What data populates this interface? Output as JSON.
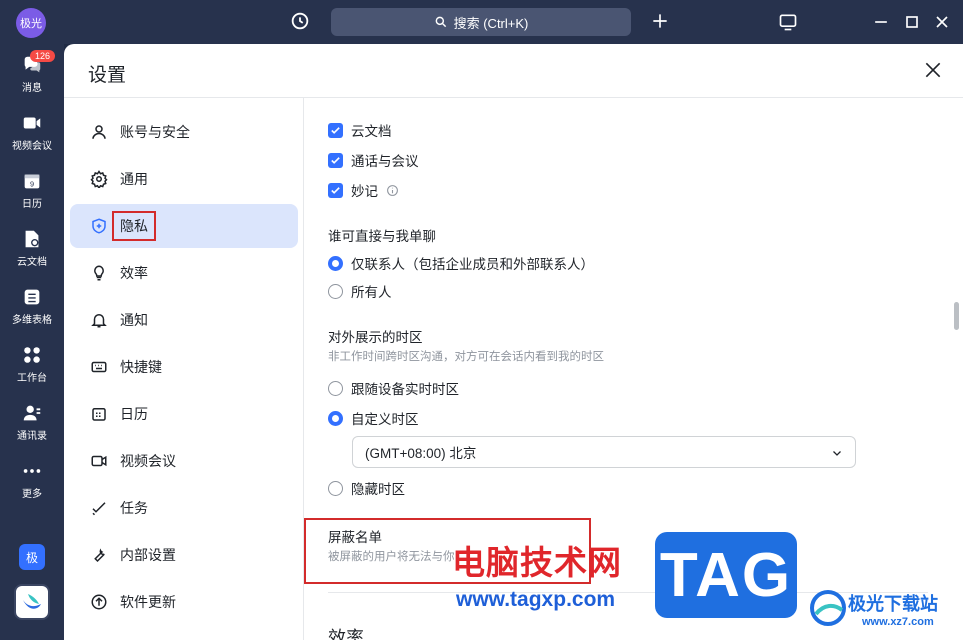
{
  "topbar": {
    "avatar_label": "极光",
    "search_label": "搜索 (Ctrl+K)"
  },
  "leftnav": {
    "items": [
      {
        "label": "消息",
        "icon": "chat-bubbles-icon",
        "badge": "126"
      },
      {
        "label": "视频会议",
        "icon": "video-camera-icon"
      },
      {
        "label": "日历",
        "icon": "calendar-icon",
        "day": "9"
      },
      {
        "label": "云文档",
        "icon": "cloud-doc-icon"
      },
      {
        "label": "多维表格",
        "icon": "grid-table-icon"
      },
      {
        "label": "工作台",
        "icon": "apps-grid-icon"
      },
      {
        "label": "通讯录",
        "icon": "contacts-icon"
      },
      {
        "label": "更多",
        "icon": "more-dots-icon"
      }
    ],
    "ji_label": "极"
  },
  "window": {
    "title": "设置"
  },
  "sidebar": {
    "items": [
      {
        "label": "账号与安全",
        "icon": "user-icon"
      },
      {
        "label": "通用",
        "icon": "gear-icon"
      },
      {
        "label": "隐私",
        "icon": "shield-icon",
        "active": true
      },
      {
        "label": "效率",
        "icon": "lightbulb-icon"
      },
      {
        "label": "通知",
        "icon": "bell-icon"
      },
      {
        "label": "快捷键",
        "icon": "keyboard-icon"
      },
      {
        "label": "日历",
        "icon": "calendar-icon"
      },
      {
        "label": "视频会议",
        "icon": "video-camera-icon"
      },
      {
        "label": "任务",
        "icon": "check-task-icon"
      },
      {
        "label": "内部设置",
        "icon": "wrench-icon"
      },
      {
        "label": "软件更新",
        "icon": "upgrade-arrow-icon"
      }
    ]
  },
  "content": {
    "checks": [
      {
        "label": "云文档",
        "checked": true
      },
      {
        "label": "通话与会议",
        "checked": true
      },
      {
        "label": "妙记",
        "checked": true
      }
    ],
    "direct_chat": {
      "title": "谁可直接与我单聊",
      "options": [
        {
          "label": "仅联系人（包括企业成员和外部联系人）",
          "selected": true
        },
        {
          "label": "所有人",
          "selected": false
        }
      ]
    },
    "timezone": {
      "title": "对外展示的时区",
      "subtitle": "非工作时间跨时区沟通，对方可在会话内看到我的时区",
      "options": [
        {
          "label": "跟随设备实时时区",
          "selected": false
        },
        {
          "label": "自定义时区",
          "selected": true
        },
        {
          "label": "隐藏时区",
          "selected": false
        }
      ],
      "select_value": "(GMT+08:00) 北京"
    },
    "blocklist": {
      "title": "屏蔽名单",
      "subtitle": "被屏蔽的用户将无法与你"
    },
    "next_section": "效率"
  },
  "watermark": {
    "cn": "电脑技术网",
    "url": "www.tagxp.com",
    "tag": "TAG",
    "site": "极光下载站",
    "site2": "www.xz7.com"
  }
}
